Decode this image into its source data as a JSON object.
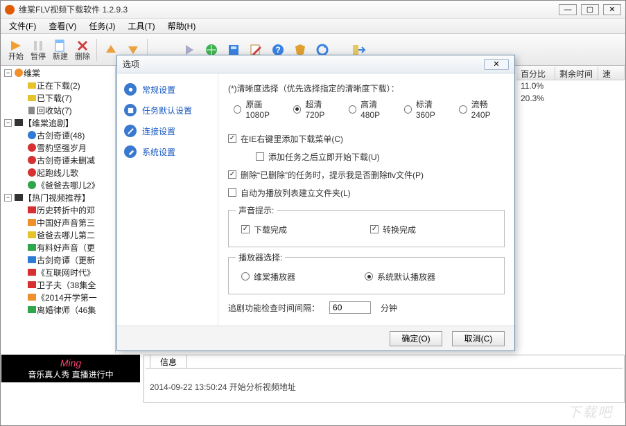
{
  "window": {
    "title": "维棠FLV视频下载软件 1.2.9.3"
  },
  "menu": {
    "file": "文件(F)",
    "view": "查看(V)",
    "task": "任务(J)",
    "tools": "工具(T)",
    "help": "帮助(H)"
  },
  "toolbar": {
    "start": "开始",
    "pause": "暂停",
    "new": "新建",
    "delete": "删除"
  },
  "tree": {
    "root": "维棠",
    "downloading": "正在下载(2)",
    "downloaded": "已下载(7)",
    "recycle": "回收站(7)",
    "drama_header": "【维棠追剧】",
    "drama": [
      "古剑奇谭(48)",
      "雪豹坚强岁月",
      "古剑奇谭未删减",
      "起跑线儿歌",
      "《爸爸去哪儿2》"
    ],
    "hot_header": "【热门视频推荐】",
    "hot": [
      "历史转折中的邓",
      "中国好声音第三",
      "爸爸去哪儿第二",
      "有料好声音（更",
      "古剑奇谭（更新",
      "《互联网时代》",
      "卫子夫（38集全",
      "《2014开学第一",
      "离婚律师（46集"
    ]
  },
  "banner": {
    "brand": "Ming",
    "tagline": "音乐真人秀 直播进行中"
  },
  "grid": {
    "cols": {
      "percent": "百分比",
      "remain": "剩余时间",
      "speed": "速"
    },
    "rows": [
      "11.0%",
      "20.3%"
    ]
  },
  "info": {
    "tab": "信息",
    "line": "2014-09-22 13:50:24 开始分析视频地址"
  },
  "watermark": "下载吧",
  "dialog": {
    "title": "选项",
    "close": "✕",
    "nav": {
      "general": "常规设置",
      "task": "任务默认设置",
      "conn": "连接设置",
      "system": "系统设置"
    },
    "clarity_label": "(*)清晰度选择（优先选择指定的清晰度下载）：",
    "clarity_opts": {
      "p1080": "原画1080P",
      "p720": "超清720P",
      "p480": "高清480P",
      "p360": "标清360P",
      "p240": "流畅240P"
    },
    "ie_menu": "在IE右键里添加下载菜单(C)",
    "ie_sub": "添加任务之后立即开始下载(U)",
    "del_prompt": "删除“已删除”的任务时，提示我是否删除flv文件(P)",
    "mk_folder": "自动为播放列表建立文件夹(L)",
    "sound_legend": "声音提示:",
    "sound_dl": "下载完成",
    "sound_cv": "转换完成",
    "player_legend": "播放器选择:",
    "player_wt": "维棠播放器",
    "player_sys": "系统默认播放器",
    "interval_label": "追剧功能检查时间间隔：",
    "interval_value": "60",
    "interval_unit": "分钟",
    "ok": "确定(O)",
    "cancel": "取消(C)"
  }
}
